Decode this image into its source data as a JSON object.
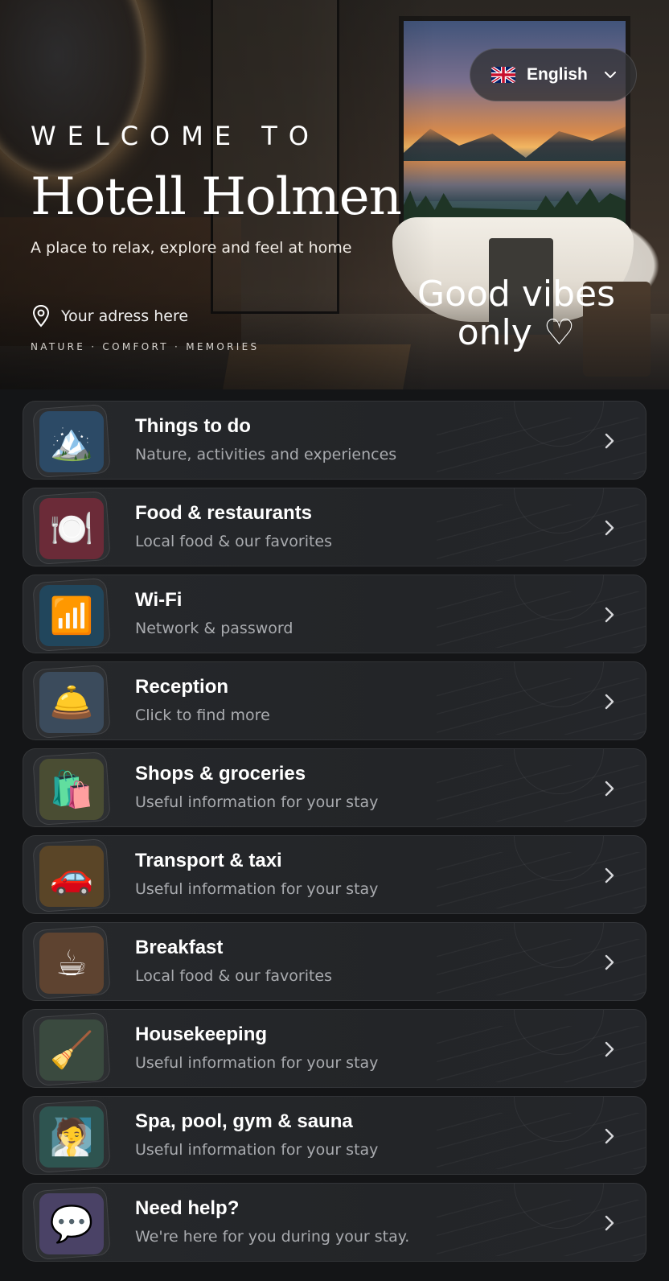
{
  "header": {
    "language": "English",
    "welcome": "WELCOME TO",
    "hotel_name": "Hotell Holmen",
    "subtitle": "A place to relax, explore and feel at home",
    "address": "Your adress here",
    "tagline": "NATURE · COMFORT · MEMORIES",
    "vibes_line1": "Good vibes",
    "vibes_line2": "only ♡"
  },
  "menu": [
    {
      "title": "Things to do",
      "subtitle": "Nature, activities and experiences",
      "icon": "🏔️",
      "icon_name": "mountain-icon",
      "color": "#2c4a66"
    },
    {
      "title": "Food & restaurants",
      "subtitle": "Local food & our favorites",
      "icon": "🍽️",
      "icon_name": "plate-cutlery-icon",
      "color": "#6b2b38"
    },
    {
      "title": "Wi-Fi",
      "subtitle": "Network & password",
      "icon": "📶",
      "icon_name": "wifi-icon",
      "color": "#21465c"
    },
    {
      "title": "Reception",
      "subtitle": "Click to find more",
      "icon": "🛎️",
      "icon_name": "bell-icon",
      "color": "#3b4b5c"
    },
    {
      "title": "Shops & groceries",
      "subtitle": "Useful information for your stay",
      "icon": "🛍️",
      "icon_name": "shopping-bags-icon",
      "color": "#4a4d33"
    },
    {
      "title": "Transport & taxi",
      "subtitle": "Useful information for your stay",
      "icon": "🚗",
      "icon_name": "car-icon",
      "color": "#5a4527"
    },
    {
      "title": "Breakfast",
      "subtitle": "Local food & our favorites",
      "icon": "☕",
      "icon_name": "coffee-icon",
      "color": "#5e4330"
    },
    {
      "title": "Housekeeping",
      "subtitle": "Useful information for your stay",
      "icon": "🧹",
      "icon_name": "broom-icon",
      "color": "#3a4a3f"
    },
    {
      "title": "Spa, pool, gym & sauna",
      "subtitle": "Useful information for your stay",
      "icon": "🧖",
      "icon_name": "spa-icon",
      "color": "#2e5450"
    },
    {
      "title": "Need help?",
      "subtitle": "We're here for you during your stay.",
      "icon": "💬",
      "icon_name": "chat-bubble-icon",
      "color": "#4a4266"
    }
  ]
}
